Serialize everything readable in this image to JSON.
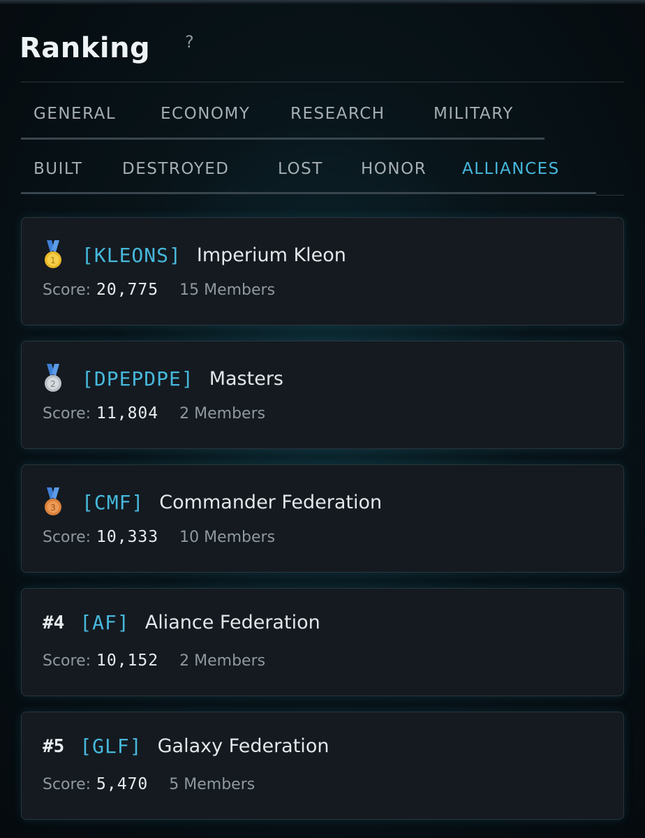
{
  "header": {
    "title": "Ranking",
    "help": "?"
  },
  "tabs_primary": [
    {
      "label": "GENERAL"
    },
    {
      "label": "ECONOMY"
    },
    {
      "label": "RESEARCH"
    },
    {
      "label": "MILITARY"
    }
  ],
  "tabs_secondary": [
    {
      "label": "BUILT"
    },
    {
      "label": "DESTROYED"
    },
    {
      "label": "LOST"
    },
    {
      "label": "HONOR"
    },
    {
      "label": "ALLIANCES",
      "active": true
    }
  ],
  "accent_color": "#47b8dc",
  "medal_colors": {
    "gold": "#e9b92b",
    "silver": "#b9bfc4",
    "bronze": "#d9813b",
    "ribbon": "#3f7fd6"
  },
  "score_label": "Score:",
  "alliances": [
    {
      "medal": "gold-medal-icon",
      "medal_num": "1",
      "rank": "",
      "tag": "[KLEONS]",
      "name": "Imperium Kleon",
      "score": "20,775",
      "members": "15 Members"
    },
    {
      "medal": "silver-medal-icon",
      "medal_num": "2",
      "rank": "",
      "tag": "[DPEPDPE]",
      "name": "Masters",
      "score": "11,804",
      "members": "2 Members"
    },
    {
      "medal": "bronze-medal-icon",
      "medal_num": "3",
      "rank": "",
      "tag": "[CMF]",
      "name": "Commander Federation",
      "score": "10,333",
      "members": "10 Members"
    },
    {
      "medal": "",
      "rank": "#4",
      "tag": "[AF]",
      "name": "Aliance Federation",
      "score": "10,152",
      "members": "2 Members"
    },
    {
      "medal": "",
      "rank": "#5",
      "tag": "[GLF]",
      "name": "Galaxy Federation",
      "score": "5,470",
      "members": "5 Members"
    }
  ]
}
